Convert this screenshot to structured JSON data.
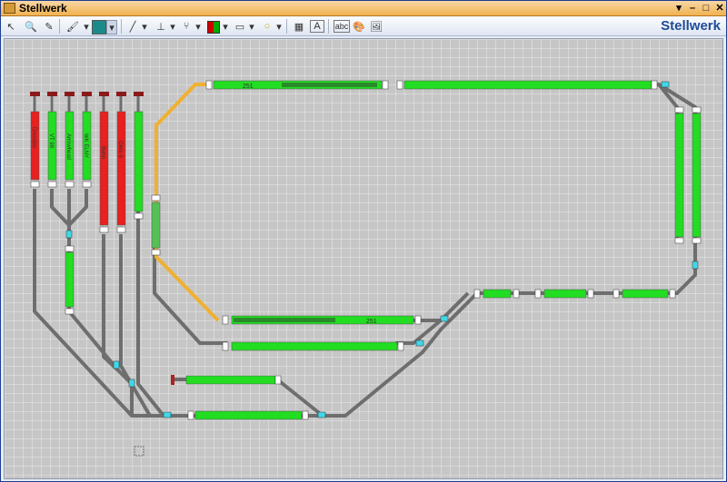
{
  "window": {
    "title": "Stellwerk",
    "controls": [
      "▾",
      "–",
      "□",
      "✕"
    ]
  },
  "toolbar": {
    "brand": "Stellwerk",
    "tools": [
      {
        "name": "pointer-icon",
        "glyph": "↖"
      },
      {
        "name": "zoom-icon",
        "glyph": "🔍"
      },
      {
        "name": "pencil-icon",
        "glyph": "✎"
      },
      {
        "name": "brush-icon",
        "glyph": "🖌"
      },
      {
        "name": "color-icon",
        "glyph": "■"
      },
      {
        "name": "line-icon",
        "glyph": "╱"
      },
      {
        "name": "track-icon",
        "glyph": "⊥"
      },
      {
        "name": "switch-icon",
        "glyph": "⑂"
      },
      {
        "name": "signal-icon",
        "glyph": "◼"
      },
      {
        "name": "block-icon",
        "glyph": "▭"
      },
      {
        "name": "circle-icon",
        "glyph": "○"
      },
      {
        "name": "counter-icon",
        "glyph": "▦"
      },
      {
        "name": "text-icon",
        "glyph": "A"
      },
      {
        "name": "label-icon",
        "glyph": "abc"
      },
      {
        "name": "palette-icon",
        "glyph": "🎨"
      },
      {
        "name": "image-icon",
        "glyph": "🖼"
      }
    ]
  },
  "colors": {
    "free": "#22dd22",
    "occupied": "#e82020",
    "route": "#f0b030",
    "rail": "#777777",
    "switch": "#40d8e8"
  },
  "blocks": [
    {
      "label": "",
      "state": "free"
    },
    {
      "label": "251",
      "state": "free"
    },
    {
      "label": "251",
      "state": "free"
    },
    {
      "label": "",
      "state": "free"
    },
    {
      "label": "",
      "state": "free"
    },
    {
      "label": "Dresden",
      "state": "occupied"
    },
    {
      "label": "VT 98",
      "state": "free"
    },
    {
      "label": "Arrowhead",
      "state": "free"
    },
    {
      "label": "WK ELNY",
      "state": "free"
    },
    {
      "label": "Bahn",
      "state": "occupied"
    },
    {
      "label": "Gleis 6",
      "state": "occupied"
    }
  ]
}
